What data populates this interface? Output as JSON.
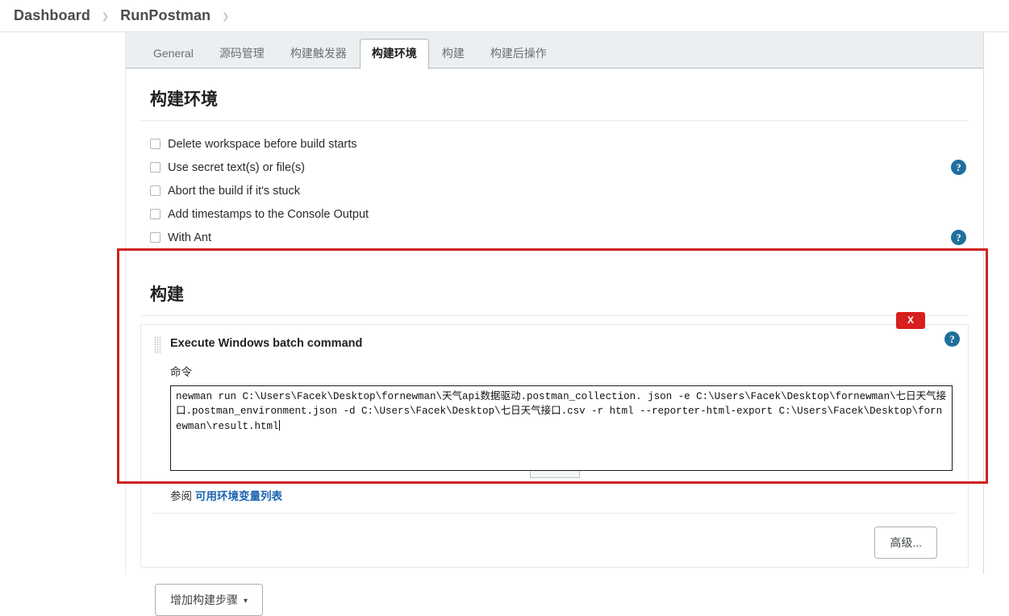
{
  "breadcrumb": {
    "items": [
      {
        "label": "Dashboard"
      },
      {
        "label": "RunPostman"
      }
    ],
    "separator": "❯"
  },
  "tabs": [
    {
      "label": "General",
      "active": false
    },
    {
      "label": "源码管理",
      "active": false
    },
    {
      "label": "构建触发器",
      "active": false
    },
    {
      "label": "构建环境",
      "active": true
    },
    {
      "label": "构建",
      "active": false
    },
    {
      "label": "构建后操作",
      "active": false
    }
  ],
  "build_environment": {
    "title": "构建环境",
    "options": [
      {
        "label": "Delete workspace before build starts",
        "checked": false,
        "help": false
      },
      {
        "label": "Use secret text(s) or file(s)",
        "checked": false,
        "help": true
      },
      {
        "label": "Abort the build if it's stuck",
        "checked": false,
        "help": false
      },
      {
        "label": "Add timestamps to the Console Output",
        "checked": false,
        "help": false
      },
      {
        "label": "With Ant",
        "checked": false,
        "help": true
      }
    ]
  },
  "build": {
    "title": "构建",
    "builder": {
      "name": "Execute Windows batch command",
      "delete_label": "X",
      "help_label": "?",
      "command_label": "命令",
      "command_value": "newman run C:\\Users\\Facek\\Desktop\\fornewman\\天气api数据驱动.postman_collection. json -e C:\\Users\\Facek\\Desktop\\fornewman\\七日天气接口.postman_environment.json -d C:\\Users\\Facek\\Desktop\\七日天气接口.csv -r html --reporter-html-export C:\\Users\\Facek\\Desktop\\fornewman\\result.html",
      "see_also_prefix": "参阅",
      "see_also_link": "可用环境变量列表"
    },
    "advanced_label": "高级...",
    "add_step_label": "增加构建步骤",
    "add_step_caret": "▾"
  },
  "icons": {
    "help": "?",
    "close": "X"
  },
  "colors": {
    "accent_link": "#1b63b0",
    "help_blue": "#1f6f9e",
    "danger_red": "#d81f1f",
    "annotation_red": "#cf2222",
    "tabbar_bg": "#eceff1"
  }
}
